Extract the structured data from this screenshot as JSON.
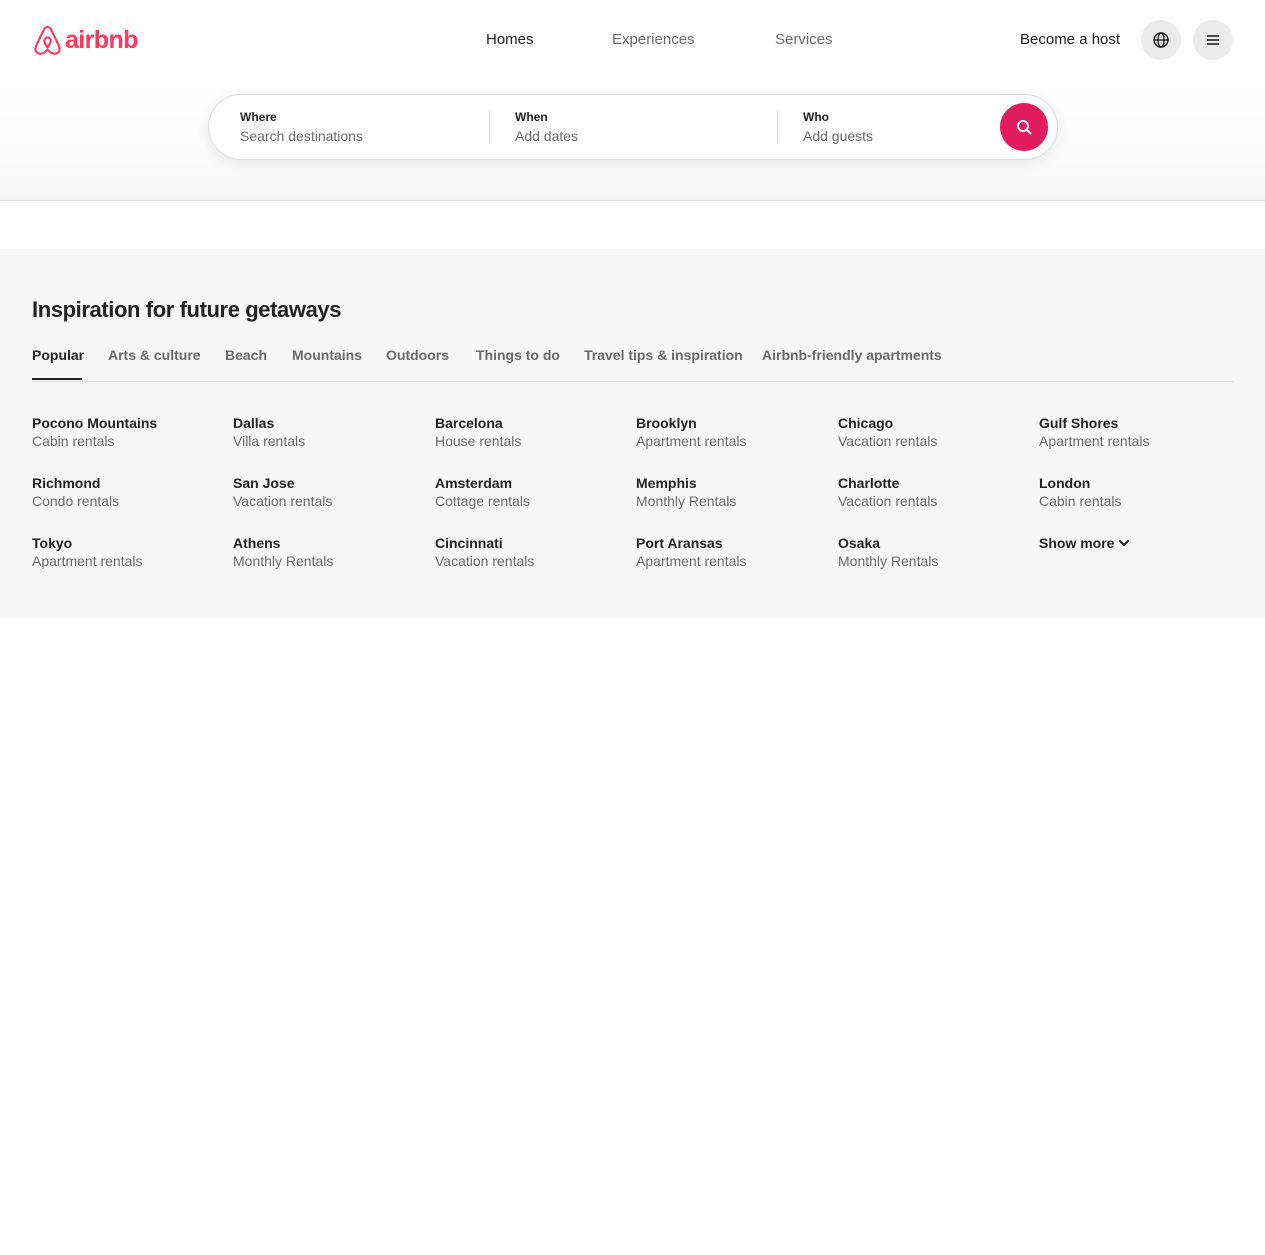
{
  "brand": {
    "name": "airbnb",
    "color": "#ff385c"
  },
  "nav": {
    "items": [
      {
        "label": "Homes",
        "active": true
      },
      {
        "label": "Experiences",
        "active": false
      },
      {
        "label": "Services",
        "active": false
      }
    ],
    "become_host": "Become a host",
    "globe_icon": "globe-icon",
    "menu_icon": "hamburger-menu-icon"
  },
  "search": {
    "where": {
      "label": "Where",
      "placeholder": "Search destinations"
    },
    "when": {
      "label": "When",
      "placeholder": "Add dates"
    },
    "who": {
      "label": "Who",
      "placeholder": "Add guests"
    },
    "button_icon": "search-icon",
    "button_color": "#e31c5f"
  },
  "inspiration": {
    "title": "Inspiration for future getaways",
    "tabs": [
      {
        "label": "Popular",
        "active": true
      },
      {
        "label": "Arts & culture",
        "active": false
      },
      {
        "label": "Beach",
        "active": false
      },
      {
        "label": "Mountains",
        "active": false
      },
      {
        "label": "Outdoors",
        "active": false
      },
      {
        "label": "Things to do",
        "active": false
      },
      {
        "label": "Travel tips & inspiration",
        "active": false
      },
      {
        "label": "Airbnb-friendly apartments",
        "active": false
      }
    ],
    "destinations": [
      {
        "name": "Pocono Mountains",
        "type": "Cabin rentals"
      },
      {
        "name": "Dallas",
        "type": "Villa rentals"
      },
      {
        "name": "Barcelona",
        "type": "House rentals"
      },
      {
        "name": "Brooklyn",
        "type": "Apartment rentals"
      },
      {
        "name": "Chicago",
        "type": "Vacation rentals"
      },
      {
        "name": "Gulf Shores",
        "type": "Apartment rentals"
      },
      {
        "name": "Richmond",
        "type": "Condo rentals"
      },
      {
        "name": "San Jose",
        "type": "Vacation rentals"
      },
      {
        "name": "Amsterdam",
        "type": "Cottage rentals"
      },
      {
        "name": "Memphis",
        "type": "Monthly Rentals"
      },
      {
        "name": "Charlotte",
        "type": "Vacation rentals"
      },
      {
        "name": "London",
        "type": "Cabin rentals"
      },
      {
        "name": "Tokyo",
        "type": "Apartment rentals"
      },
      {
        "name": "Athens",
        "type": "Monthly Rentals"
      },
      {
        "name": "Cincinnati",
        "type": "Vacation rentals"
      },
      {
        "name": "Port Aransas",
        "type": "Apartment rentals"
      },
      {
        "name": "Osaka",
        "type": "Monthly Rentals"
      }
    ],
    "show_more": "Show more",
    "show_more_icon": "chevron-down-icon"
  }
}
